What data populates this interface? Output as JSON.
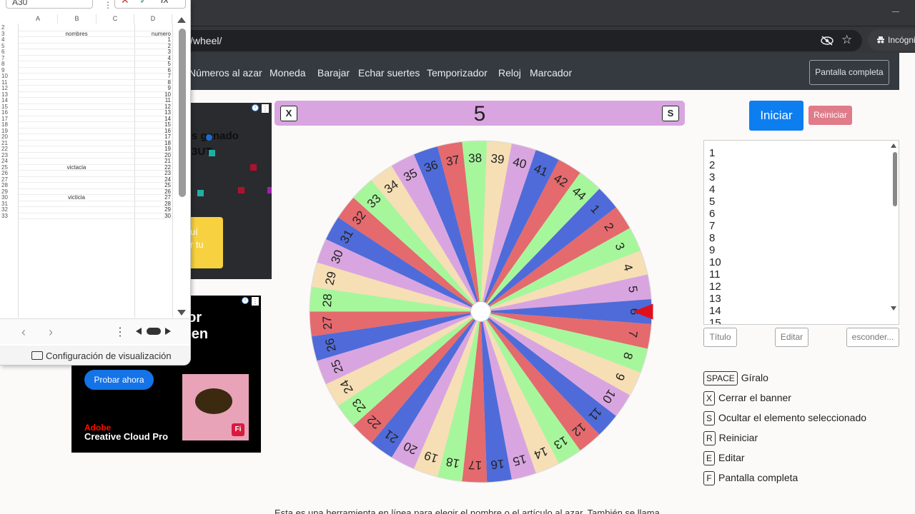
{
  "browser": {
    "url": "/wheel/",
    "incognito_label": "Incógnito"
  },
  "nav": {
    "links": [
      "Números al azar",
      "Moneda",
      "Barajar",
      "Echar suertes",
      "Temporizador",
      "Reloj",
      "Marcador"
    ],
    "fullscreen": "Pantalla completa"
  },
  "ad1": {
    "line1": "s ganado",
    "line2": "3UT",
    "cta1": "uí",
    "cta2": "r tu"
  },
  "ad2": {
    "headline1": "bor",
    "headline2": "n en",
    "headline3": "r",
    "cta": "Probar ahora",
    "brand1": "Adobe",
    "brand2": "Creative Cloud Pro",
    "app_badge": "Fi"
  },
  "spreadsheet": {
    "name_box": "A30",
    "columns": [
      "A",
      "B",
      "C",
      "D"
    ],
    "header_row": {
      "row": "3",
      "B": "nombres",
      "D": "numero"
    },
    "rows": [
      {
        "r": "2",
        "c": "",
        "d": ""
      },
      {
        "r": "4",
        "c": "",
        "d": "1"
      },
      {
        "r": "5",
        "c": "",
        "d": "2"
      },
      {
        "r": "6",
        "c": "",
        "d": "3"
      },
      {
        "r": "7",
        "c": "",
        "d": "4"
      },
      {
        "r": "8",
        "c": "",
        "d": "5"
      },
      {
        "r": "9",
        "c": "",
        "d": "6"
      },
      {
        "r": "10",
        "c": "",
        "d": "7"
      },
      {
        "r": "11",
        "c": "",
        "d": "8"
      },
      {
        "r": "12",
        "c": "",
        "d": "9"
      },
      {
        "r": "13",
        "c": "",
        "d": "10"
      },
      {
        "r": "14",
        "c": "",
        "d": "11"
      },
      {
        "r": "15",
        "c": "",
        "d": "12"
      },
      {
        "r": "16",
        "c": "",
        "d": "13"
      },
      {
        "r": "17",
        "c": "",
        "d": "14"
      },
      {
        "r": "18",
        "c": "",
        "d": "15"
      },
      {
        "r": "19",
        "c": "",
        "d": "16"
      },
      {
        "r": "20",
        "c": "",
        "d": "17"
      },
      {
        "r": "21",
        "c": "",
        "d": "18"
      },
      {
        "r": "22",
        "c": "",
        "d": "19"
      },
      {
        "r": "23",
        "c": "",
        "d": "20"
      },
      {
        "r": "24",
        "c": "",
        "d": "21"
      },
      {
        "r": "25",
        "c": "victacia",
        "d": "22"
      },
      {
        "r": "26",
        "c": "",
        "d": "23"
      },
      {
        "r": "27",
        "c": "",
        "d": "24"
      },
      {
        "r": "28",
        "c": "",
        "d": "25"
      },
      {
        "r": "29",
        "c": "",
        "d": "26"
      },
      {
        "r": "30",
        "c": "victicia",
        "d": "27"
      },
      {
        "r": "31",
        "c": "",
        "d": "28"
      },
      {
        "r": "32",
        "c": "",
        "d": "29"
      },
      {
        "r": "33",
        "c": "",
        "d": "30"
      }
    ],
    "view_settings": "Configuración de visualización"
  },
  "wheel": {
    "selected": "5",
    "close_key": "X",
    "hide_key": "S",
    "segments": [
      "1",
      "2",
      "3",
      "4",
      "5",
      "6",
      "7",
      "8",
      "9",
      "10",
      "11",
      "12",
      "13",
      "14",
      "15",
      "16",
      "17",
      "18",
      "19",
      "20",
      "21",
      "22",
      "23",
      "24",
      "25",
      "26",
      "27",
      "28",
      "29",
      "30",
      "31",
      "32",
      "33",
      "34",
      "35",
      "36",
      "37",
      "38",
      "39",
      "40",
      "41",
      "42",
      "44"
    ],
    "colors": [
      "#4f6bd9",
      "#e46a6e",
      "#a6f79b",
      "#f6dfb5",
      "#d9a5e0"
    ]
  },
  "controls": {
    "start": "Iniciar",
    "reset": "Reiniciar",
    "list_text": "1\n2\n3\n4\n5\n6\n7\n8\n9\n10\n11\n12\n13\n14\n15",
    "title_btn": "Título",
    "edit_btn": "Editar",
    "hide_btn": "esconder..."
  },
  "shortcuts": [
    {
      "key": "SPACE",
      "label": "Gíralo"
    },
    {
      "key": "X",
      "label": "Cerrar el banner"
    },
    {
      "key": "S",
      "label": "Ocultar el elemento seleccionado"
    },
    {
      "key": "R",
      "label": "Reiniciar"
    },
    {
      "key": "E",
      "label": "Editar"
    },
    {
      "key": "F",
      "label": "Pantalla completa"
    }
  ],
  "footer_text": "Esta es una herramienta en línea para elegir el nombre o el artículo al azar. También se llama"
}
